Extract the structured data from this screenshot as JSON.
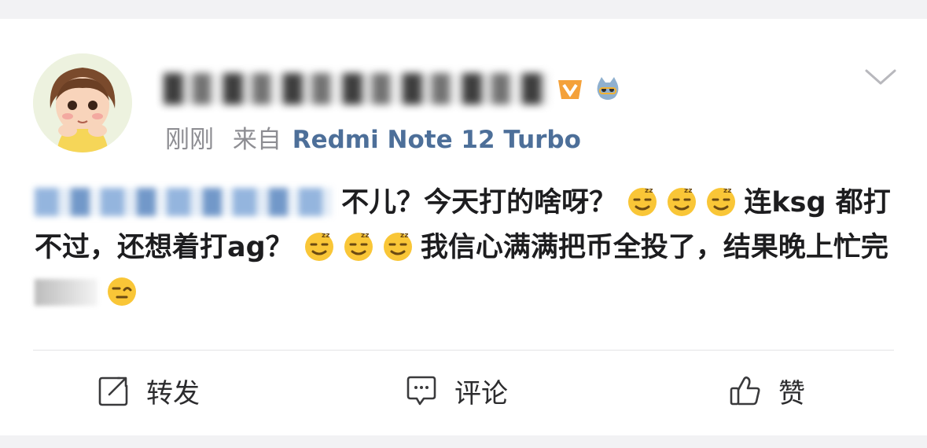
{
  "post": {
    "time": "刚刚",
    "source_prefix": "来自",
    "source_device": "Redmi Note 12 Turbo",
    "text_part1": " 不儿？今天打的啥呀？",
    "text_part2": "连ksg 都打不过，还想着打ag？",
    "text_part3": "我信心满满把币全投了，结果晚上忙完",
    "emoji_names": [
      "smirk-emoji",
      "smirk-emoji",
      "smirk-emoji",
      "smirk-emoji",
      "smirk-emoji",
      "smirk-emoji",
      "wink-emoji"
    ]
  },
  "actions": {
    "repost": "转发",
    "comment": "评论",
    "like": "赞"
  },
  "colors": {
    "link": "#4d6f99",
    "text": "#1d1d1f",
    "muted": "#8e8e93",
    "emoji": "#f9c637"
  }
}
